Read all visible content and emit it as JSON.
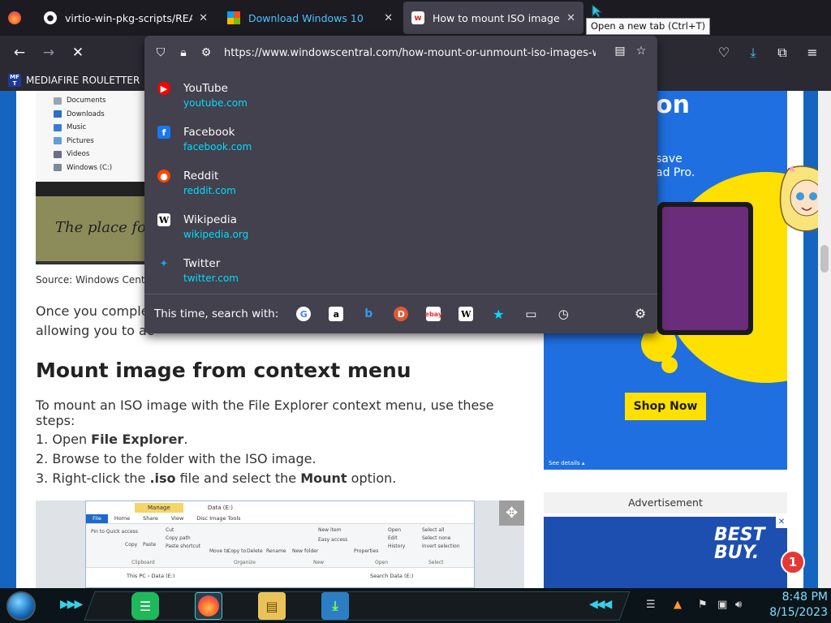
{
  "tabs": [
    {
      "title": "virtio-win-pkg-scripts/README.m",
      "favicon": "github-icon"
    },
    {
      "title": "Download Windows 10",
      "favicon": "windows-icon"
    },
    {
      "title": "How to mount ISO images on W",
      "favicon": "windowscentral-icon",
      "selected": true
    }
  ],
  "tooltip": "Open a new tab (Ctrl+T)",
  "urlbar": {
    "url": "https://www.windowscentral.com/how-mount-or-unmount-iso-images-win",
    "results": [
      {
        "title": "YouTube",
        "url": "youtube.com",
        "icon": "youtube-icon",
        "color": "#ff0000"
      },
      {
        "title": "Facebook",
        "url": "facebook.com",
        "icon": "facebook-icon",
        "color": "#1877f2"
      },
      {
        "title": "Reddit",
        "url": "reddit.com",
        "icon": "reddit-icon",
        "color": "#ff4500"
      },
      {
        "title": "Wikipedia",
        "url": "wikipedia.org",
        "icon": "wikipedia-icon",
        "color": "#ffffff"
      },
      {
        "title": "Twitter",
        "url": "twitter.com",
        "icon": "twitter-icon",
        "color": "#1da1f2"
      }
    ],
    "search_with_label": "This time, search with:",
    "engines": [
      "google-icon",
      "amazon-icon",
      "bing-icon",
      "duckduckgo-icon",
      "ebay-icon",
      "wikipedia-icon",
      "bookmarks-icon",
      "tabs-icon",
      "history-icon"
    ]
  },
  "bookmarks": {
    "item1": "MEDIAFIRE ROULETTER",
    "item1_icon_text": "MF T"
  },
  "article": {
    "explorer_items": [
      "Documents",
      "Downloads",
      "Music",
      "Pictures",
      "Videos",
      "Windows (C:)"
    ],
    "promo_text": "The place for",
    "caption": "Source: Windows Centra",
    "para1_line1": "Once you complet",
    "para1_line2": "allowing you to ac",
    "heading": "Mount image from context menu",
    "intro": "To mount an ISO image with the File Explorer context menu, use these steps:",
    "steps": [
      {
        "num": "1. Open ",
        "bold": "File Explorer",
        "rest": "."
      },
      {
        "num": "2. Browse to the folder with the ISO image.",
        "bold": "",
        "rest": ""
      },
      {
        "num": "3. Right-click the ",
        "bold": ".iso",
        "rest": " file and select the ",
        "bold2": "Mount",
        "rest2": " option."
      }
    ],
    "explorer_window": {
      "manage": "Manage",
      "title": "Data (E:)",
      "ribbon_tabs": [
        "File",
        "Home",
        "Share",
        "View",
        "Disc Image Tools"
      ],
      "groups": [
        "Clipboard",
        "Organize",
        "New",
        "Open",
        "Select"
      ],
      "buttons": [
        "Pin to Quick access",
        "Copy",
        "Paste",
        "Cut",
        "Copy path",
        "Paste shortcut",
        "Move to",
        "Copy to",
        "Delete",
        "Rename",
        "New folder",
        "New item",
        "Easy access",
        "Properties",
        "Open",
        "Edit",
        "History",
        "Select all",
        "Select none",
        "Invert selection"
      ],
      "path": "This PC › Data (E:)",
      "search": "Search Data (E:)"
    }
  },
  "ad": {
    "headline_fragment": "on",
    "sub1": "save",
    "sub2": "ad Pro.",
    "shop": "Shop Now",
    "details": "See details ▴"
  },
  "ad2": {
    "header": "Advertisement",
    "brand_line1": "BEST",
    "brand_line2": "BUY."
  },
  "notification_count": "1",
  "taskbar": {
    "time": "8:48 PM",
    "date": "8/15/2023"
  }
}
